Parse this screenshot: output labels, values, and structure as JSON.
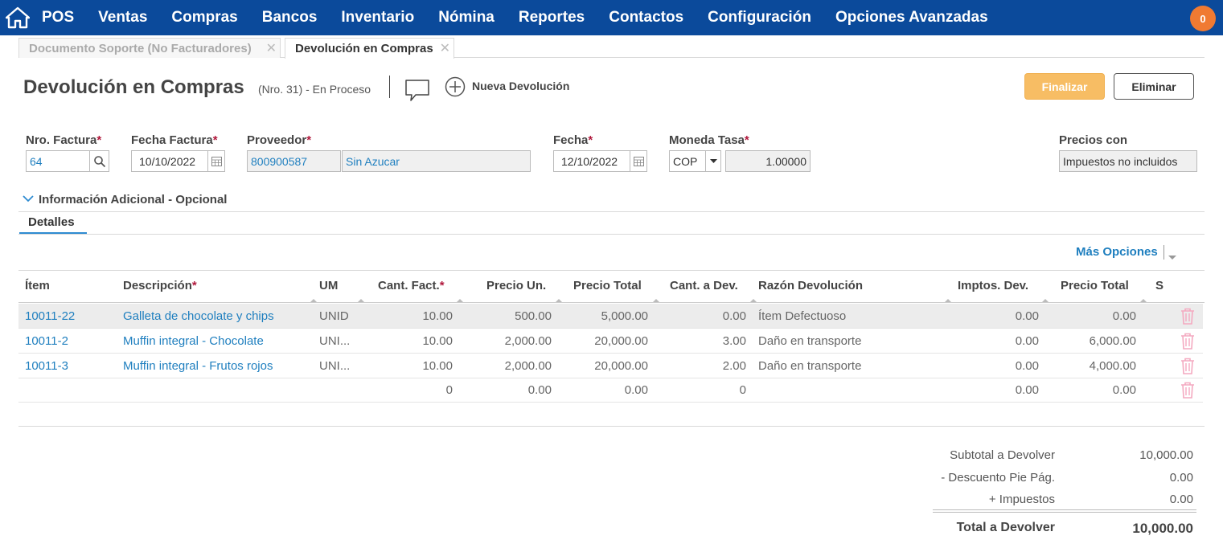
{
  "nav": {
    "items": [
      "POS",
      "Ventas",
      "Compras",
      "Bancos",
      "Inventario",
      "Nómina",
      "Reportes",
      "Contactos",
      "Configuración",
      "Opciones Avanzadas"
    ],
    "notifications": "0"
  },
  "tabs": [
    {
      "label": "Documento Soporte (No Facturadores)"
    },
    {
      "label": "Devolución en Compras"
    }
  ],
  "header": {
    "title": "Devolución en Compras",
    "subtitle": "(Nro. 31) - En Proceso",
    "new_label": "Nueva Devolución",
    "finalize": "Finalizar",
    "delete": "Eliminar"
  },
  "form": {
    "invoice_no_label": "Nro. Factura",
    "invoice_no": "64",
    "invoice_date_label": "Fecha Factura",
    "invoice_date": "10/10/2022",
    "supplier_label": "Proveedor",
    "supplier_id": "800900587",
    "supplier_name": "Sin Azucar",
    "date_label": "Fecha",
    "date": "12/10/2022",
    "currency_label": "Moneda Tasa",
    "currency": "COP",
    "rate": "1.00000",
    "prices_label": "Precios con",
    "prices": "Impuestos no incluidos",
    "required_mark": "*"
  },
  "additional": "Información Adicional - Opcional",
  "details_tab": "Detalles",
  "more_options": "Más Opciones",
  "table": {
    "headers": [
      "Ítem",
      "Descripción",
      "UM",
      "Cant. Fact.",
      "Precio Un.",
      "Precio Total",
      "Cant. a Dev.",
      "Razón Devolución",
      "Imptos. Dev.",
      "Precio Total",
      "S"
    ],
    "rows": [
      {
        "item": "10011-22",
        "desc": "Galleta de chocolate y chips",
        "um": "UNID",
        "qty": "10.00",
        "unit": "500.00",
        "total": "5,000.00",
        "ret": "0.00",
        "reason": "Ítem Defectuoso",
        "tax": "0.00",
        "rtotal": "0.00"
      },
      {
        "item": "10011-2",
        "desc": "Muffin integral - Chocolate",
        "um": "UNI...",
        "qty": "10.00",
        "unit": "2,000.00",
        "total": "20,000.00",
        "ret": "3.00",
        "reason": "Daño en transporte",
        "tax": "0.00",
        "rtotal": "6,000.00"
      },
      {
        "item": "10011-3",
        "desc": "Muffin integral - Frutos rojos",
        "um": "UNI...",
        "qty": "10.00",
        "unit": "2,000.00",
        "total": "20,000.00",
        "ret": "2.00",
        "reason": "Daño en transporte",
        "tax": "0.00",
        "rtotal": "4,000.00"
      },
      {
        "item": "",
        "desc": "",
        "um": "",
        "qty": "0",
        "unit": "0.00",
        "total": "0.00",
        "ret": "0",
        "reason": "",
        "tax": "0.00",
        "rtotal": "0.00"
      }
    ]
  },
  "totals": {
    "subtotal_label": "Subtotal a Devolver",
    "subtotal": "10,000.00",
    "discount_label": "- Descuento Pie Pág.",
    "discount": "0.00",
    "taxes_label": "+ Impuestos",
    "taxes": "0.00",
    "total_label": "Total a Devolver",
    "total": "10,000.00"
  },
  "colors": {
    "nav": "#0b4a9b",
    "accent": "#f7bd64",
    "link": "#1f7fbf",
    "required": "#b0183c",
    "trash": "#f4a9c0"
  }
}
